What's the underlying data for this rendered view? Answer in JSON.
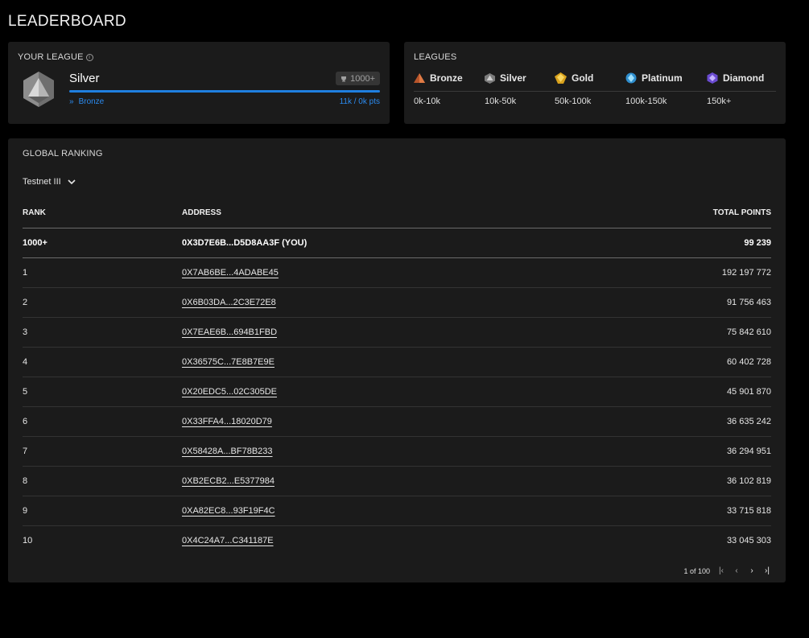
{
  "page_title": "LEADERBOARD",
  "your_league": {
    "label": "YOUR LEAGUE",
    "info_glyph": "i",
    "current": "Silver",
    "points_chip": "1000+",
    "progress": 1.0,
    "previous_league": "Bronze",
    "points_progress": "11k / 0k pts"
  },
  "leagues": {
    "label": "LEAGUES",
    "items": [
      {
        "name": "Bronze",
        "range": "0k-10k",
        "color": "#c8663a",
        "icon": "bronze-pyramid-icon"
      },
      {
        "name": "Silver",
        "range": "10k-50k",
        "color": "#9a9a9a",
        "icon": "silver-gem-icon"
      },
      {
        "name": "Gold",
        "range": "50k-100k",
        "color": "#e8b92e",
        "icon": "gold-gem-icon"
      },
      {
        "name": "Platinum",
        "range": "100k-150k",
        "color": "#4fb3e6",
        "icon": "platinum-gem-icon"
      },
      {
        "name": "Diamond",
        "range": "150k+",
        "color": "#8a6ae0",
        "icon": "diamond-gem-icon"
      }
    ]
  },
  "ranking": {
    "label": "GLOBAL RANKING",
    "season": "Testnet III",
    "columns": {
      "rank": "RANK",
      "address": "ADDRESS",
      "points": "TOTAL POINTS"
    },
    "you": {
      "rank": "1000+",
      "address": "0X3D7E6B...D5D8AA3F (YOU)",
      "points": "99 239"
    },
    "rows": [
      {
        "rank": "1",
        "address": "0X7AB6BE...4ADABE45",
        "points": "192 197 772"
      },
      {
        "rank": "2",
        "address": "0X6B03DA...2C3E72E8",
        "points": "91 756 463"
      },
      {
        "rank": "3",
        "address": "0X7EAE6B...694B1FBD",
        "points": "75 842 610"
      },
      {
        "rank": "4",
        "address": "0X36575C...7E8B7E9E",
        "points": "60 402 728"
      },
      {
        "rank": "5",
        "address": "0X20EDC5...02C305DE",
        "points": "45 901 870"
      },
      {
        "rank": "6",
        "address": "0X33FFA4...18020D79",
        "points": "36 635 242"
      },
      {
        "rank": "7",
        "address": "0X58428A...BF78B233",
        "points": "36 294 951"
      },
      {
        "rank": "8",
        "address": "0XB2ECB2...E5377984",
        "points": "36 102 819"
      },
      {
        "rank": "9",
        "address": "0XA82EC8...93F19F4C",
        "points": "33 715 818"
      },
      {
        "rank": "10",
        "address": "0X4C24A7...C341187E",
        "points": "33 045 303"
      }
    ],
    "pagination": {
      "text": "1 of 100",
      "first": "|‹",
      "prev": "‹",
      "next": "›",
      "last": "›|"
    }
  }
}
